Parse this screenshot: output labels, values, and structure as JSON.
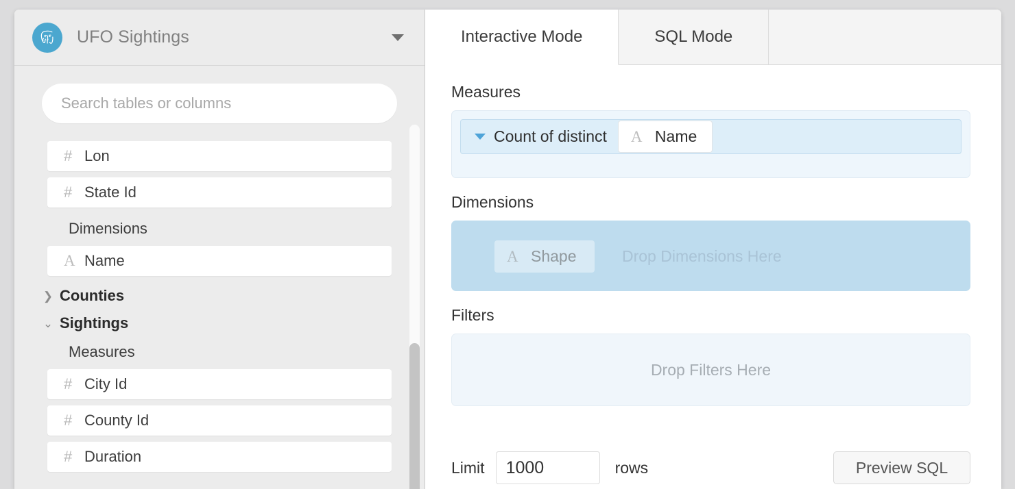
{
  "window": {
    "database": {
      "name": "UFO Sightings",
      "logo_icon": "postgresql-elephant-icon",
      "dropdown_icon": "chevron-down-icon",
      "accent_color": "#4ba7cf"
    },
    "search": {
      "placeholder": "Search tables or columns",
      "value": "",
      "icon": "search-input"
    },
    "sidebar": {
      "top_columns": [
        {
          "icon": "number-icon",
          "glyph": "#",
          "label": "Lon"
        },
        {
          "icon": "number-icon",
          "glyph": "#",
          "label": "State Id"
        }
      ],
      "dimensions_group_label": "Dimensions",
      "dimension_columns": [
        {
          "icon": "text-icon",
          "glyph": "A",
          "label": "Name"
        }
      ],
      "tables": [
        {
          "label": "Counties",
          "expanded": false,
          "chevron": "chevron-right-icon"
        },
        {
          "label": "Sightings",
          "expanded": true,
          "chevron": "chevron-down-icon"
        }
      ],
      "measures_group_label": "Measures",
      "measure_columns": [
        {
          "icon": "number-icon",
          "glyph": "#",
          "label": "City Id"
        },
        {
          "icon": "number-icon",
          "glyph": "#",
          "label": "County Id"
        },
        {
          "icon": "number-icon",
          "glyph": "#",
          "label": "Duration"
        }
      ]
    },
    "tabs": [
      {
        "label": "Interactive Mode",
        "active": true
      },
      {
        "label": "SQL Mode",
        "active": false
      }
    ],
    "builder": {
      "measures": {
        "title": "Measures",
        "pill": {
          "caret_icon": "caret-down-icon",
          "aggregate": "Count of distinct",
          "field_icon": "text-icon",
          "field_glyph": "A",
          "field": "Name"
        }
      },
      "dimensions": {
        "title": "Dimensions",
        "drop_hint": "Drop Dimensions Here",
        "dragging_chip": {
          "icon": "text-icon",
          "glyph": "A",
          "label": "Shape"
        },
        "highlight_color": "#bedcee"
      },
      "filters": {
        "title": "Filters",
        "drop_hint": "Drop Filters Here"
      }
    },
    "footer": {
      "limit_label": "Limit",
      "limit_value": "1000",
      "rows_label": "rows",
      "preview_button": "Preview SQL"
    }
  }
}
